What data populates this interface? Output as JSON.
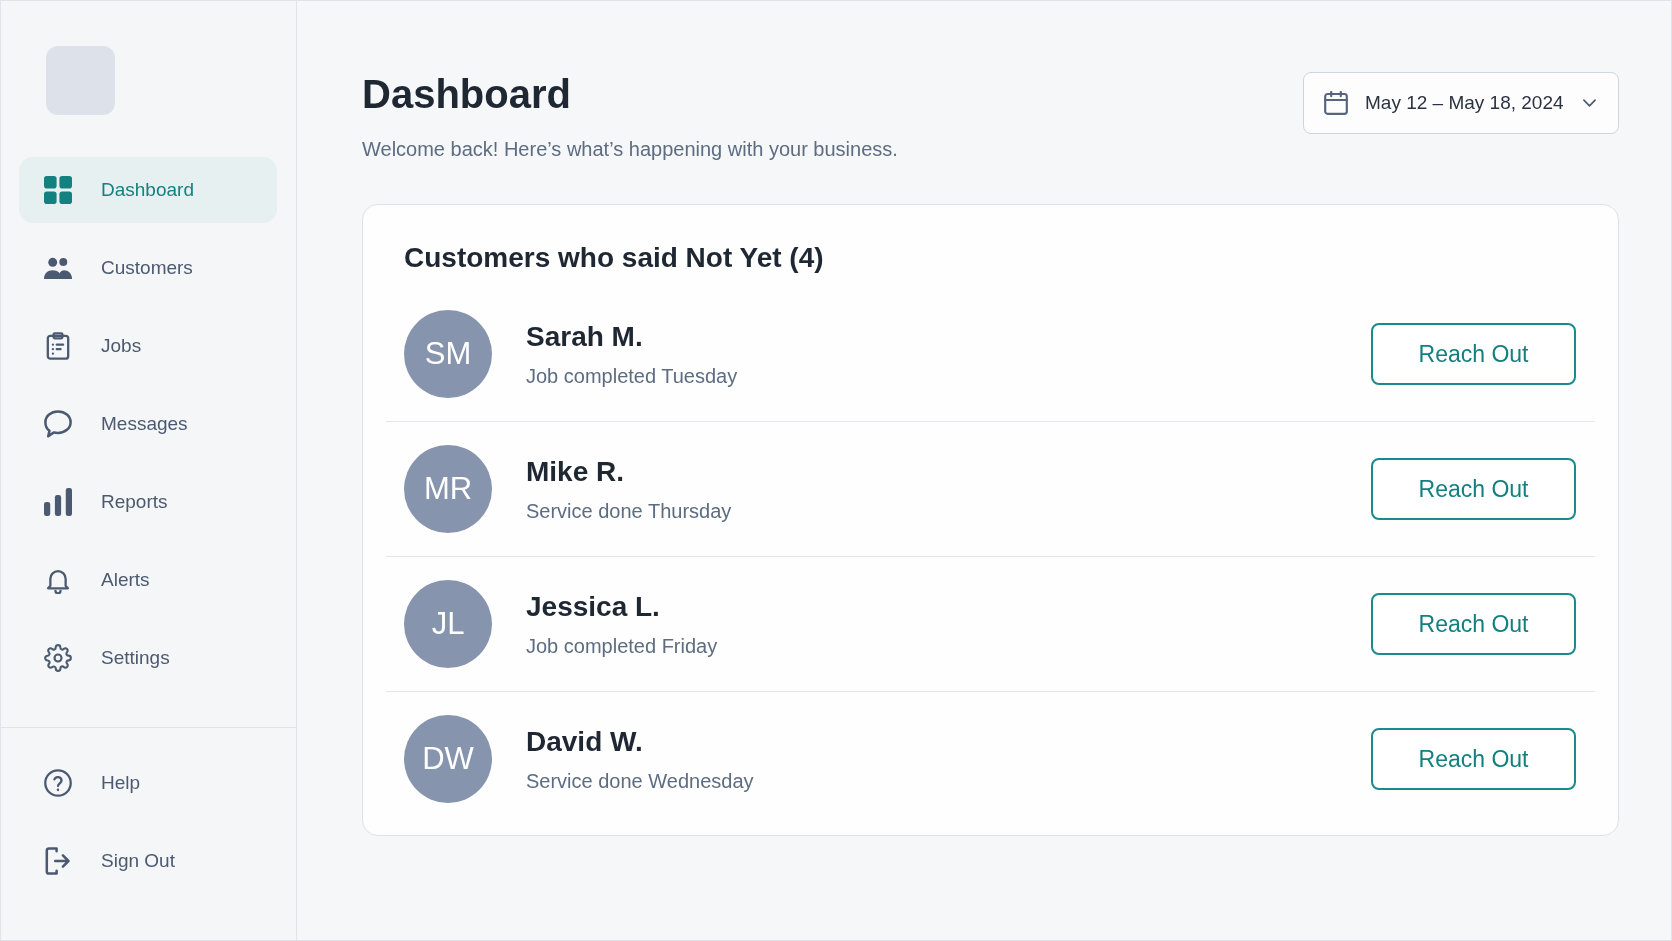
{
  "sidebar": {
    "nav_items": [
      {
        "label": "Dashboard",
        "selected": true
      },
      {
        "label": "Customers",
        "selected": false
      },
      {
        "label": "Jobs",
        "selected": false
      },
      {
        "label": "Messages",
        "selected": false
      },
      {
        "label": "Reports",
        "selected": false
      },
      {
        "label": "Alerts",
        "selected": false
      },
      {
        "label": "Settings",
        "selected": false
      }
    ],
    "footer_items": [
      {
        "label": "Help",
        "selected": false
      },
      {
        "label": "Sign Out",
        "selected": false
      }
    ]
  },
  "header": {
    "title": "Dashboard",
    "subtitle": "Welcome back! Here’s what’s happening with your business.",
    "date_range": "May 12 – May 18, 2024"
  },
  "customers_card": {
    "title": "Customers who said Not Yet (4)",
    "rows": [
      {
        "initials": "SM",
        "name": "Sarah M.",
        "detail": "Job completed Tuesday",
        "action": "Reach Out"
      },
      {
        "initials": "MR",
        "name": "Mike R.",
        "detail": "Service done Thursday",
        "action": "Reach Out"
      },
      {
        "initials": "JL",
        "name": "Jessica L.",
        "detail": "Job completed Friday",
        "action": "Reach Out"
      },
      {
        "initials": "DW",
        "name": "David W.",
        "detail": "Service done Wednesday",
        "action": "Reach Out"
      }
    ]
  }
}
